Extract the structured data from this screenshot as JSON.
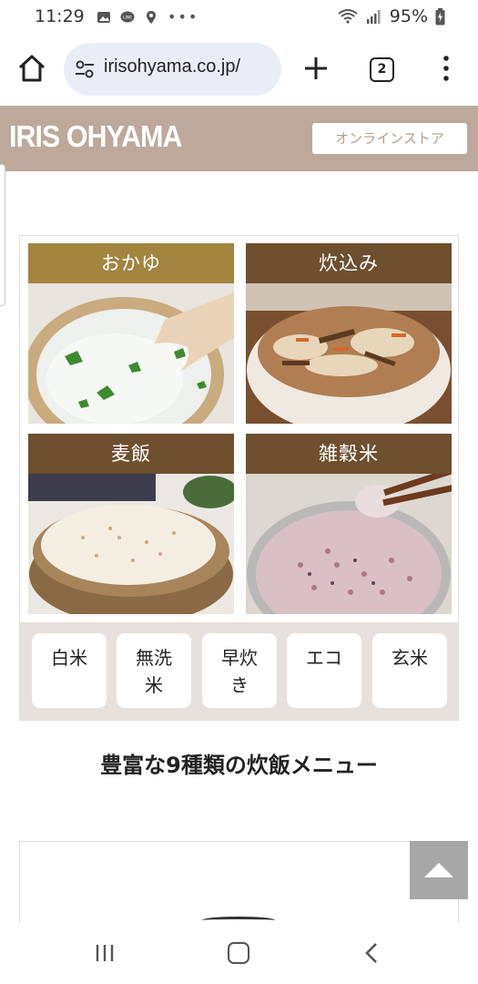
{
  "status_bar": {
    "time": "11:29",
    "battery": "95%",
    "icons": [
      "gallery-icon",
      "line-icon",
      "location-icon",
      "more-dots-icon",
      "wifi-icon",
      "signal-icon",
      "battery-charging-icon"
    ]
  },
  "browser": {
    "url": "irisohyama.co.jp/",
    "tab_count": "2"
  },
  "site": {
    "logo": "IRIS OHYAMA",
    "store_button": "オンラインストア"
  },
  "menu": {
    "tiles": [
      {
        "label": "おかゆ",
        "color": "#a2843f"
      },
      {
        "label": "炊込み",
        "color": "#6e4f2e"
      },
      {
        "label": "麦飯",
        "color": "#6e4f2e"
      },
      {
        "label": "雑穀米",
        "color": "#6e4f2e"
      }
    ],
    "buttons": [
      {
        "line1": "白米",
        "line2": ""
      },
      {
        "line1": "無洗",
        "line2": "米"
      },
      {
        "line1": "早炊",
        "line2": "き"
      },
      {
        "line1": "エコ",
        "line2": ""
      },
      {
        "line1": "玄米",
        "line2": ""
      }
    ],
    "caption": "豊富な9種類の炊飯メニュー"
  },
  "colors": {
    "header_bg": "#bca99b",
    "tile_label_gold": "#a2843f",
    "tile_label_brown": "#6e4f2e",
    "button_strip": "#e6e1dc"
  }
}
